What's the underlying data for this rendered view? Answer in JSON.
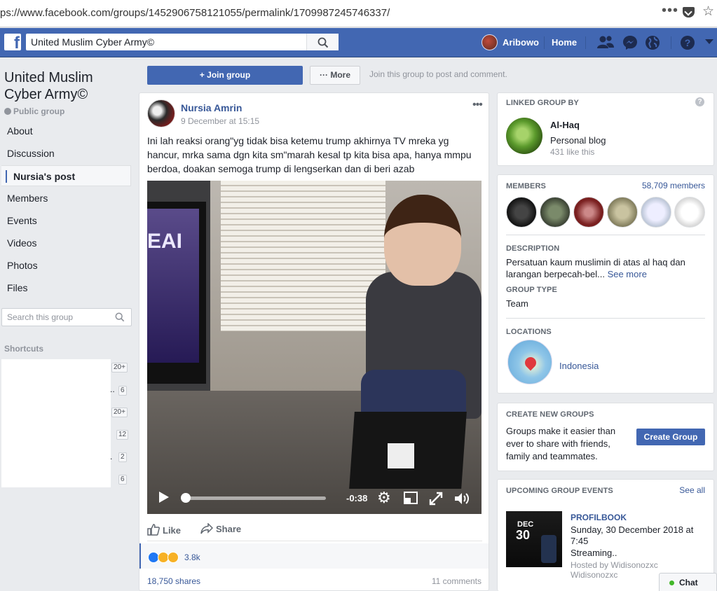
{
  "browser": {
    "url": "ps://www.facebook.com/groups/1452906758121055/permalink/1709987245746337/",
    "menu_icon": "ellipsis-icon",
    "pocket_icon": "pocket-icon",
    "star_icon": "star-icon"
  },
  "topbar": {
    "logo": "f",
    "search_value": "United Muslim Cyber Army©",
    "user_name": "Aribowo",
    "home_label": "Home",
    "brand_color": "#4267b2"
  },
  "group": {
    "title": "United Muslim Cyber Army©",
    "privacy": "Public group",
    "nav": [
      {
        "label": "About"
      },
      {
        "label": "Discussion"
      },
      {
        "label": "Nursia's post"
      },
      {
        "label": "Members"
      },
      {
        "label": "Events"
      },
      {
        "label": "Videos"
      },
      {
        "label": "Photos"
      },
      {
        "label": "Files"
      }
    ],
    "search_placeholder": "Search this group",
    "shortcuts_title": "Shortcuts",
    "shortcut_badges": [
      "20+",
      "6",
      "20+",
      "12",
      "2",
      "6"
    ]
  },
  "actions": {
    "join_label": "Join group",
    "more_label": "More",
    "hint": "Join this group to post and comment."
  },
  "post": {
    "author": "Nursia Amrin",
    "time": "9 December at 15:15",
    "text": "Ini lah reaksi orang\"yg tidak bisa ketemu trump akhirnya TV mreka yg hancur, mrka sama dgn kita sm\"marah kesal tp kita bisa apa, hanya mmpu berdoa, doakan semoga trump di lengserkan dan di beri azab",
    "video": {
      "tv_text": "EAI",
      "time_remaining": "-0:38",
      "progress": 0.0
    },
    "like_label": "Like",
    "share_label": "Share",
    "reactions_count": "3.8k",
    "shares": "18,750 shares",
    "comments": "11 comments"
  },
  "sidebar": {
    "linked": {
      "title": "LINKED GROUP BY",
      "name": "Al-Haq",
      "category": "Personal blog",
      "likes": "431 like this"
    },
    "members": {
      "title": "MEMBERS",
      "count": "58,709 members"
    },
    "description": {
      "title": "DESCRIPTION",
      "text": "Persatuan kaum muslimin di atas al haq dan larangan berpecah-bel...",
      "see_more": "See more"
    },
    "group_type": {
      "title": "GROUP TYPE",
      "value": "Team"
    },
    "locations": {
      "title": "LOCATIONS",
      "value": "Indonesia"
    },
    "create": {
      "title": "CREATE NEW GROUPS",
      "text": "Groups make it easier than ever to share with friends, family and teammates.",
      "button": "Create Group"
    },
    "events": {
      "title": "UPCOMING GROUP EVENTS",
      "see_all": "See all",
      "month": "DEC",
      "day": "30",
      "name": "PROFILBOOK",
      "date": "Sunday, 30 December 2018 at 7:45",
      "status": "Streaming..",
      "host": "Hosted by Widisonozxc Widisonozxc"
    }
  },
  "chat": {
    "label": "Chat",
    "status_color": "#42b72a"
  }
}
